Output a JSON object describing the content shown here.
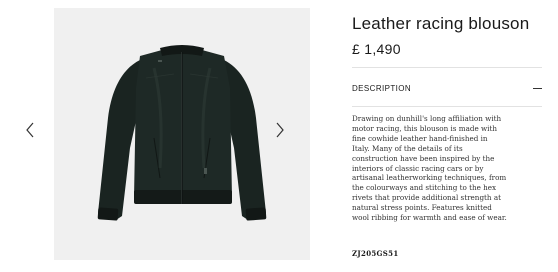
{
  "product": {
    "title": "Leather racing blouson",
    "price": "£ 1,490",
    "sku": "ZJ205GS51",
    "image_icon": "leather-jacket-image"
  },
  "gallery": {
    "prev_icon": "chevron-left-icon",
    "next_icon": "chevron-right-icon"
  },
  "description": {
    "label": "DESCRIPTION",
    "toggle_icon": "minus-icon",
    "lines": [
      "Drawing on dunhill's long affiliation with",
      "motor racing, this blouson is made with",
      "fine cowhide leather hand-finished in",
      "Italy. Many of the details of its",
      "construction have been inspired by the",
      "interiors of classic racing cars or by",
      "artisanal leatherworking techniques, from",
      "the colourways and stitching to the hex",
      "rivets that provide additional strength at",
      "natural stress points. Features knitted",
      "wool ribbing for warmth and ease of wear."
    ]
  },
  "colors": {
    "gallery_bg": "#f0f0f0",
    "jacket": "#1c2623",
    "divider": "#e2e2e2"
  }
}
